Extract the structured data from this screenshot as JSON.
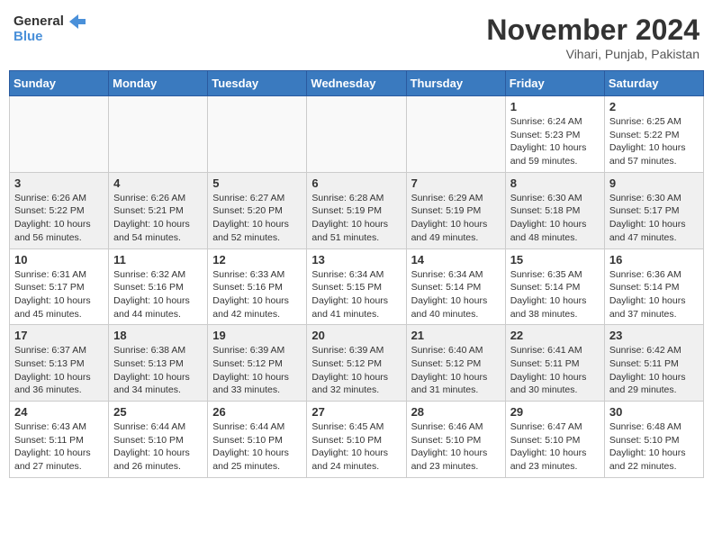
{
  "logo": {
    "line1": "General",
    "line2": "Blue"
  },
  "title": "November 2024",
  "location": "Vihari, Punjab, Pakistan",
  "weekdays": [
    "Sunday",
    "Monday",
    "Tuesday",
    "Wednesday",
    "Thursday",
    "Friday",
    "Saturday"
  ],
  "weeks": [
    [
      {
        "day": "",
        "info": ""
      },
      {
        "day": "",
        "info": ""
      },
      {
        "day": "",
        "info": ""
      },
      {
        "day": "",
        "info": ""
      },
      {
        "day": "",
        "info": ""
      },
      {
        "day": "1",
        "info": "Sunrise: 6:24 AM\nSunset: 5:23 PM\nDaylight: 10 hours and 59 minutes."
      },
      {
        "day": "2",
        "info": "Sunrise: 6:25 AM\nSunset: 5:22 PM\nDaylight: 10 hours and 57 minutes."
      }
    ],
    [
      {
        "day": "3",
        "info": "Sunrise: 6:26 AM\nSunset: 5:22 PM\nDaylight: 10 hours and 56 minutes."
      },
      {
        "day": "4",
        "info": "Sunrise: 6:26 AM\nSunset: 5:21 PM\nDaylight: 10 hours and 54 minutes."
      },
      {
        "day": "5",
        "info": "Sunrise: 6:27 AM\nSunset: 5:20 PM\nDaylight: 10 hours and 52 minutes."
      },
      {
        "day": "6",
        "info": "Sunrise: 6:28 AM\nSunset: 5:19 PM\nDaylight: 10 hours and 51 minutes."
      },
      {
        "day": "7",
        "info": "Sunrise: 6:29 AM\nSunset: 5:19 PM\nDaylight: 10 hours and 49 minutes."
      },
      {
        "day": "8",
        "info": "Sunrise: 6:30 AM\nSunset: 5:18 PM\nDaylight: 10 hours and 48 minutes."
      },
      {
        "day": "9",
        "info": "Sunrise: 6:30 AM\nSunset: 5:17 PM\nDaylight: 10 hours and 47 minutes."
      }
    ],
    [
      {
        "day": "10",
        "info": "Sunrise: 6:31 AM\nSunset: 5:17 PM\nDaylight: 10 hours and 45 minutes."
      },
      {
        "day": "11",
        "info": "Sunrise: 6:32 AM\nSunset: 5:16 PM\nDaylight: 10 hours and 44 minutes."
      },
      {
        "day": "12",
        "info": "Sunrise: 6:33 AM\nSunset: 5:16 PM\nDaylight: 10 hours and 42 minutes."
      },
      {
        "day": "13",
        "info": "Sunrise: 6:34 AM\nSunset: 5:15 PM\nDaylight: 10 hours and 41 minutes."
      },
      {
        "day": "14",
        "info": "Sunrise: 6:34 AM\nSunset: 5:14 PM\nDaylight: 10 hours and 40 minutes."
      },
      {
        "day": "15",
        "info": "Sunrise: 6:35 AM\nSunset: 5:14 PM\nDaylight: 10 hours and 38 minutes."
      },
      {
        "day": "16",
        "info": "Sunrise: 6:36 AM\nSunset: 5:14 PM\nDaylight: 10 hours and 37 minutes."
      }
    ],
    [
      {
        "day": "17",
        "info": "Sunrise: 6:37 AM\nSunset: 5:13 PM\nDaylight: 10 hours and 36 minutes."
      },
      {
        "day": "18",
        "info": "Sunrise: 6:38 AM\nSunset: 5:13 PM\nDaylight: 10 hours and 34 minutes."
      },
      {
        "day": "19",
        "info": "Sunrise: 6:39 AM\nSunset: 5:12 PM\nDaylight: 10 hours and 33 minutes."
      },
      {
        "day": "20",
        "info": "Sunrise: 6:39 AM\nSunset: 5:12 PM\nDaylight: 10 hours and 32 minutes."
      },
      {
        "day": "21",
        "info": "Sunrise: 6:40 AM\nSunset: 5:12 PM\nDaylight: 10 hours and 31 minutes."
      },
      {
        "day": "22",
        "info": "Sunrise: 6:41 AM\nSunset: 5:11 PM\nDaylight: 10 hours and 30 minutes."
      },
      {
        "day": "23",
        "info": "Sunrise: 6:42 AM\nSunset: 5:11 PM\nDaylight: 10 hours and 29 minutes."
      }
    ],
    [
      {
        "day": "24",
        "info": "Sunrise: 6:43 AM\nSunset: 5:11 PM\nDaylight: 10 hours and 27 minutes."
      },
      {
        "day": "25",
        "info": "Sunrise: 6:44 AM\nSunset: 5:10 PM\nDaylight: 10 hours and 26 minutes."
      },
      {
        "day": "26",
        "info": "Sunrise: 6:44 AM\nSunset: 5:10 PM\nDaylight: 10 hours and 25 minutes."
      },
      {
        "day": "27",
        "info": "Sunrise: 6:45 AM\nSunset: 5:10 PM\nDaylight: 10 hours and 24 minutes."
      },
      {
        "day": "28",
        "info": "Sunrise: 6:46 AM\nSunset: 5:10 PM\nDaylight: 10 hours and 23 minutes."
      },
      {
        "day": "29",
        "info": "Sunrise: 6:47 AM\nSunset: 5:10 PM\nDaylight: 10 hours and 23 minutes."
      },
      {
        "day": "30",
        "info": "Sunrise: 6:48 AM\nSunset: 5:10 PM\nDaylight: 10 hours and 22 minutes."
      }
    ]
  ]
}
